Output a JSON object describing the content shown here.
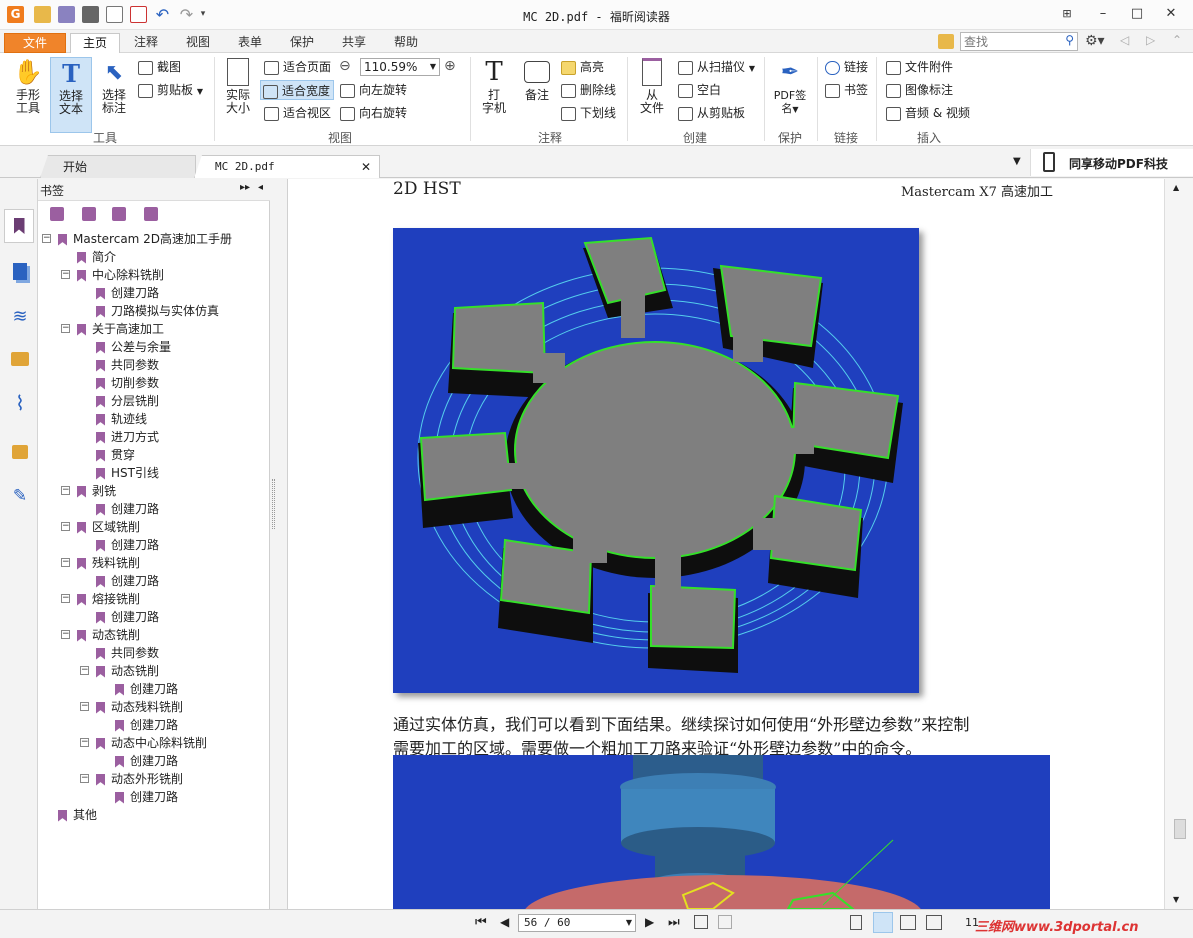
{
  "window": {
    "title": "MC 2D.pdf - 福昕阅读器",
    "controls": {
      "minimize": "–",
      "restore": "□",
      "close": "✕"
    }
  },
  "quick_access": [
    "app-logo",
    "open",
    "save",
    "print",
    "properties",
    "new",
    "undo",
    "redo",
    "customize"
  ],
  "ribbon_tabs": [
    {
      "label": "文件"
    },
    {
      "label": "主页"
    },
    {
      "label": "注释"
    },
    {
      "label": "视图"
    },
    {
      "label": "表单"
    },
    {
      "label": "保护"
    },
    {
      "label": "共享"
    },
    {
      "label": "帮助"
    }
  ],
  "search": {
    "placeholder": "查找"
  },
  "ribbon": {
    "tools": {
      "hand_line1": "手形",
      "hand_line2": "工具",
      "select_text_line1": "选择",
      "select_text_line2": "文本",
      "select_annot_line1": "选择",
      "select_annot_line2": "标注",
      "snapshot": "截图",
      "clipboard": "剪贴板",
      "group_label": "工具"
    },
    "view": {
      "actual_line1": "实际",
      "actual_line2": "大小",
      "fit_page": "适合页面",
      "fit_width": "适合宽度",
      "fit_visible": "适合视区",
      "zoom_value": "110.59%",
      "rotate_left": "向左旋转",
      "rotate_right": "向右旋转",
      "group_label": "视图"
    },
    "comment": {
      "typewriter_line1": "打",
      "typewriter_line2": "字机",
      "note": "备注",
      "highlight": "高亮",
      "strikeout": "删除线",
      "underline": "下划线",
      "group_label": "注释"
    },
    "create": {
      "from_file_line1": "从",
      "from_file_line2": "文件",
      "from_scanner": "从扫描仪",
      "blank": "空白",
      "from_clipboard": "从剪贴板",
      "group_label": "创建"
    },
    "protect": {
      "pdf_sign_line1": "PDF签",
      "pdf_sign_line2": "名",
      "group_label": "保护"
    },
    "links": {
      "link": "链接",
      "bookmark": "书签",
      "group_label": "链接"
    },
    "insert": {
      "file_attachment": "文件附件",
      "image_annotation": "图像标注",
      "audio_video": "音频 & 视频",
      "group_label": "插入"
    }
  },
  "doc_tabs": [
    {
      "label": "开始"
    },
    {
      "label": "MC 2D.pdf"
    }
  ],
  "promo": {
    "label": "同享移动PDF科技"
  },
  "bookmarks_panel": {
    "title": "书签",
    "items": [
      {
        "label": "Mastercam 2D高速加工手册",
        "level": 0,
        "expand": "−"
      },
      {
        "label": "简介",
        "level": 1,
        "expand": ""
      },
      {
        "label": "中心除料铣削",
        "level": 1,
        "expand": "−"
      },
      {
        "label": "创建刀路",
        "level": 2,
        "expand": ""
      },
      {
        "label": "刀路模拟与实体仿真",
        "level": 2,
        "expand": ""
      },
      {
        "label": "关于高速加工",
        "level": 1,
        "expand": "−"
      },
      {
        "label": "公差与余量",
        "level": 2,
        "expand": ""
      },
      {
        "label": "共同参数",
        "level": 2,
        "expand": ""
      },
      {
        "label": "切削参数",
        "level": 2,
        "expand": ""
      },
      {
        "label": "分层铣削",
        "level": 2,
        "expand": ""
      },
      {
        "label": "轨迹线",
        "level": 2,
        "expand": ""
      },
      {
        "label": "进刀方式",
        "level": 2,
        "expand": ""
      },
      {
        "label": "贯穿",
        "level": 2,
        "expand": ""
      },
      {
        "label": "HST引线",
        "level": 2,
        "expand": ""
      },
      {
        "label": "剥铣",
        "level": 1,
        "expand": "−"
      },
      {
        "label": "创建刀路",
        "level": 2,
        "expand": ""
      },
      {
        "label": "区域铣削",
        "level": 1,
        "expand": "−"
      },
      {
        "label": "创建刀路",
        "level": 2,
        "expand": ""
      },
      {
        "label": "残料铣削",
        "level": 1,
        "expand": "−"
      },
      {
        "label": "创建刀路",
        "level": 2,
        "expand": ""
      },
      {
        "label": "熔接铣削",
        "level": 1,
        "expand": "−"
      },
      {
        "label": "创建刀路",
        "level": 2,
        "expand": ""
      },
      {
        "label": "动态铣削",
        "level": 1,
        "expand": "−"
      },
      {
        "label": "共同参数",
        "level": 2,
        "expand": ""
      },
      {
        "label": "动态铣削",
        "level": 2,
        "expand": "−"
      },
      {
        "label": "创建刀路",
        "level": 3,
        "expand": ""
      },
      {
        "label": "动态残料铣削",
        "level": 2,
        "expand": "−"
      },
      {
        "label": "创建刀路",
        "level": 3,
        "expand": ""
      },
      {
        "label": "动态中心除料铣削",
        "level": 2,
        "expand": "−"
      },
      {
        "label": "创建刀路",
        "level": 3,
        "expand": ""
      },
      {
        "label": "动态外形铣削",
        "level": 2,
        "expand": "−"
      },
      {
        "label": "创建刀路",
        "level": 3,
        "expand": ""
      },
      {
        "label": "其他",
        "level": 0,
        "expand": ""
      }
    ]
  },
  "page": {
    "header_left": "2D HST",
    "header_right": "Mastercam X7 高速加工",
    "paragraph_line1": "通过实体仿真，我们可以看到下面结果。继续探讨如何使用“外形壁边参数”来控制",
    "paragraph_line2": "需要加工的区域。需要做一个粗加工刀路来验证“外形壁边参数”中的命令。"
  },
  "status": {
    "page_indicator": "56 / 60",
    "zoom_short": "11",
    "watermark": "三维网www.3dportal.cn"
  },
  "colors": {
    "accent_orange": "#f0842a",
    "selected_blue": "#cfe4f7",
    "bookmark_purple": "#9b5fa0",
    "render_blue": "#1f3fbe"
  }
}
